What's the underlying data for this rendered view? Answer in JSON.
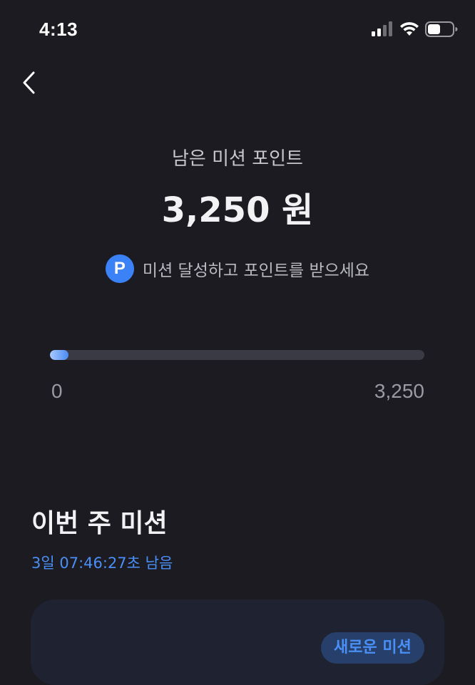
{
  "status_bar": {
    "time": "4:13"
  },
  "header": {
    "back_icon": "chevron-left-icon"
  },
  "points": {
    "label": "남은 미션 포인트",
    "amount": "3,250 원",
    "promo_badge": "P",
    "promo_text": "미션 달성하고 포인트를 받으세요"
  },
  "progress": {
    "min_label": "0",
    "max_label": "3,250",
    "fraction": 0.05
  },
  "missions": {
    "title": "이번 주 미션",
    "countdown": "3일 07:46:27초 남음",
    "new_badge": "새로운 미션"
  },
  "colors": {
    "background": "#1b1b21",
    "accent": "#4a8ff5",
    "badge": "#3b82f6"
  }
}
